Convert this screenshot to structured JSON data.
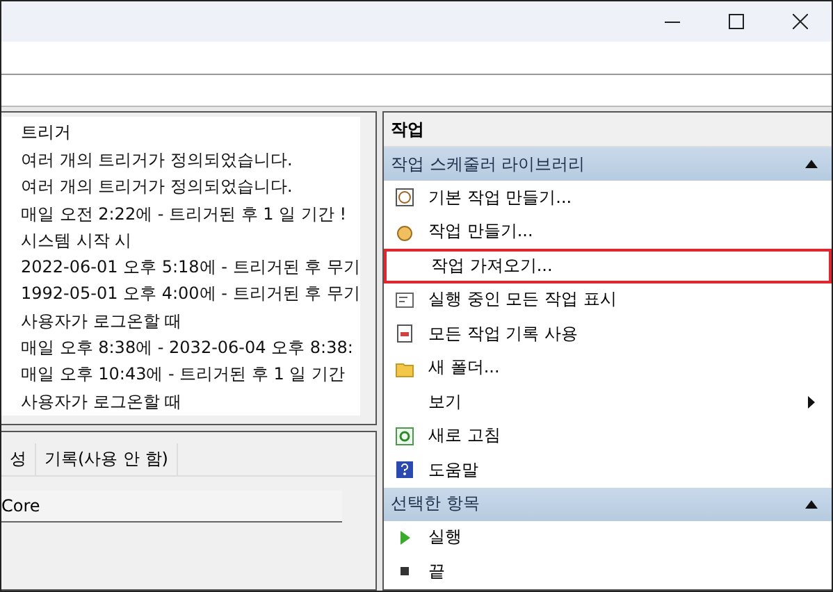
{
  "trigger_list": {
    "column": "트리거",
    "rows": [
      "여러 개의 트리거가 정의되었습니다.",
      "여러 개의 트리거가 정의되었습니다.",
      "매일 오전 2:22에 - 트리거된 후 1 일 기간 !",
      "시스템 시작 시",
      "2022-06-01 오후 5:18에 - 트리거된 후 무기",
      "1992-05-01 오후 4:00에 - 트리거된 후 무기",
      "사용자가 로그온할 때",
      "매일 오후 8:38에 - 2032-06-04 오후 8:38:",
      "매일 오후 10:43에 - 트리거된 후 1 일 기간",
      "사용자가 로그온할 때"
    ]
  },
  "detail_tabs": [
    {
      "label": "성",
      "selected": false
    },
    {
      "label": "기록(사용 안 함)",
      "selected": false
    }
  ],
  "detail": {
    "field": "Core"
  },
  "actions": {
    "title": "작업",
    "sections": [
      {
        "title": "작업 스케줄러 라이브러리",
        "expanded": true,
        "items": [
          {
            "label": "기본 작업 만들기...",
            "highlighted": false,
            "submenu": false
          },
          {
            "label": "작업 만들기...",
            "highlighted": false,
            "submenu": false
          },
          {
            "label": "작업 가져오기...",
            "highlighted": true,
            "submenu": false
          },
          {
            "label": "실행 중인 모든 작업 표시",
            "highlighted": false,
            "submenu": false
          },
          {
            "label": "모든 작업 기록 사용",
            "highlighted": false,
            "submenu": false
          },
          {
            "label": "새 폴더...",
            "highlighted": false,
            "submenu": false
          },
          {
            "label": "보기",
            "highlighted": false,
            "submenu": true
          },
          {
            "label": "새로 고침",
            "highlighted": false,
            "submenu": false
          },
          {
            "label": "도움말",
            "highlighted": false,
            "submenu": false
          }
        ]
      },
      {
        "title": "선택한 항목",
        "expanded": true,
        "items": [
          {
            "label": "실행",
            "highlighted": false,
            "submenu": false
          },
          {
            "label": "끝",
            "highlighted": false,
            "submenu": false
          }
        ]
      }
    ]
  }
}
